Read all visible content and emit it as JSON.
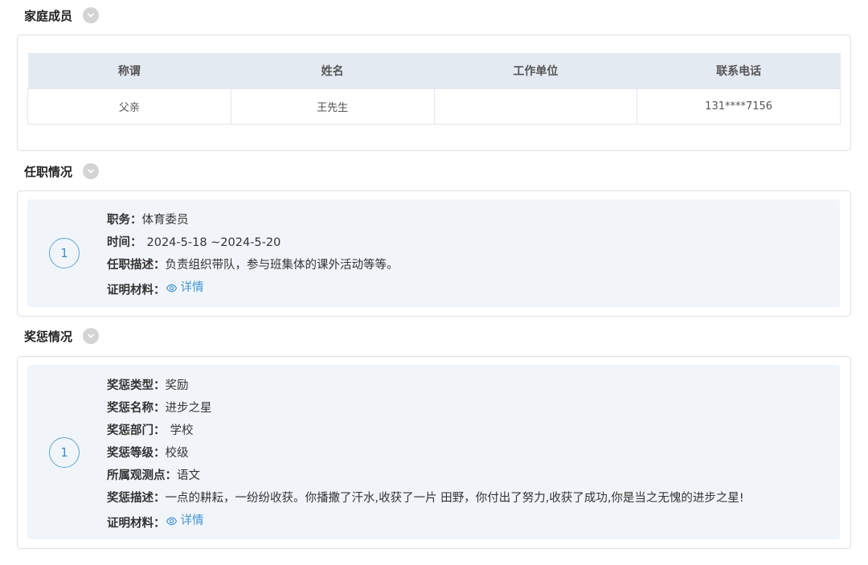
{
  "family": {
    "title": "家庭成员",
    "columns": [
      "称谓",
      "姓名",
      "工作单位",
      "联系电话"
    ],
    "rows": [
      [
        "父亲",
        "王先生",
        "",
        "131****7156"
      ]
    ]
  },
  "positions": {
    "title": "任职情况",
    "items": [
      {
        "index": "1",
        "duty_label": "职务：",
        "duty": "体育委员",
        "time_label": "时间：",
        "time": "2024-5-18 ~2024-5-20",
        "desc_label": "任职描述：",
        "desc": "负责组织带队，参与班集体的课外活动等等。",
        "proof_label": "证明材料：",
        "proof_link": "详情"
      }
    ]
  },
  "awards": {
    "title": "奖惩情况",
    "items": [
      {
        "index": "1",
        "type_label": "奖惩类型：",
        "type": "奖励",
        "name_label": "奖惩名称：",
        "name": "进步之星",
        "dept_label": "奖惩部门：",
        "dept": "学校",
        "level_label": "奖惩等级：",
        "level": "校级",
        "point_label": "所属观测点：",
        "point": "语文",
        "desc_label": "奖惩描述：",
        "desc": "一点的耕耘，一纷纷收获。你播撒了汗水,收获了一片 田野，你付出了努力,收获了成功,你是当之无愧的进步之星!",
        "proof_label": "证明材料：",
        "proof_link": "详情"
      }
    ]
  },
  "icons": {
    "toggle": "chevron-down-icon",
    "proof": "eye-icon"
  },
  "colors": {
    "accent": "#3e94db",
    "table_header_bg": "#e3eaf1",
    "item_bg": "#f1f5f9"
  }
}
